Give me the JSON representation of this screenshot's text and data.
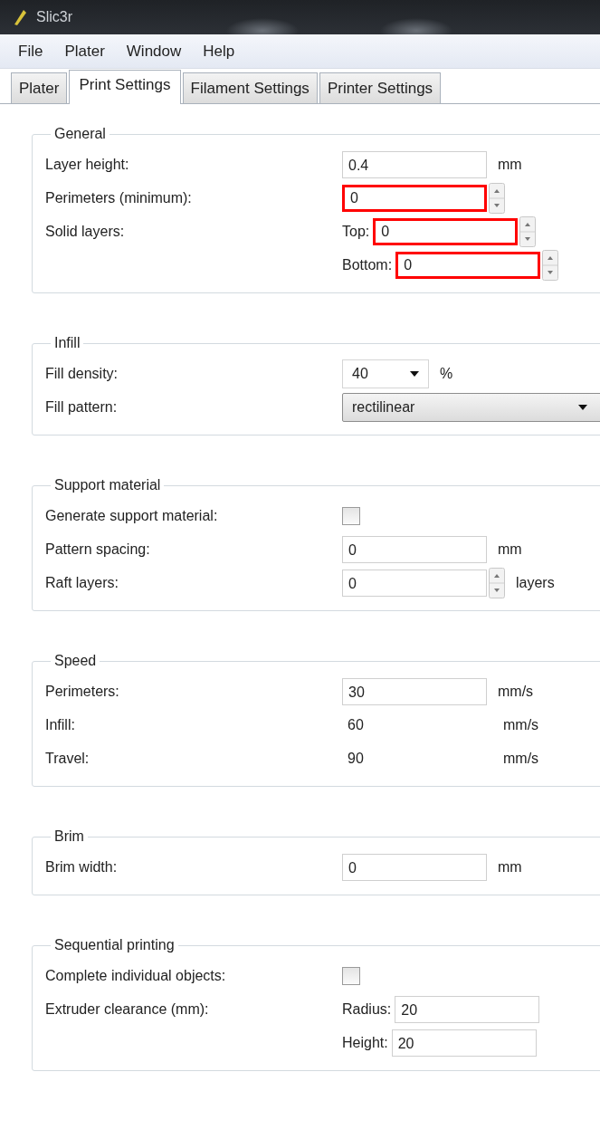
{
  "window": {
    "title": "Slic3r"
  },
  "menu": [
    "File",
    "Plater",
    "Window",
    "Help"
  ],
  "tabs": [
    {
      "label": "Plater",
      "selected": false
    },
    {
      "label": "Print Settings",
      "selected": true
    },
    {
      "label": "Filament Settings",
      "selected": false
    },
    {
      "label": "Printer Settings",
      "selected": false
    }
  ],
  "sections": [
    {
      "title": "General",
      "rows": [
        {
          "label": "Layer height:",
          "fields": [
            {
              "kind": "text",
              "value": "0.4",
              "unit": "mm",
              "highlighted": false
            }
          ]
        },
        {
          "label": "Perimeters (minimum):",
          "fields": [
            {
              "kind": "spin",
              "value": "0",
              "highlighted": true
            }
          ]
        },
        {
          "label": "Solid layers:",
          "fields": [
            {
              "kind": "spin",
              "label": "Top:",
              "value": "0",
              "highlighted": true
            },
            {
              "kind": "spin",
              "label": "Bottom:",
              "value": "0",
              "highlighted": true
            }
          ]
        }
      ]
    },
    {
      "title": "Infill",
      "rows": [
        {
          "label": "Fill density:",
          "fields": [
            {
              "kind": "combo",
              "value": "40",
              "unit": "%"
            }
          ]
        },
        {
          "label": "Fill pattern:",
          "fields": [
            {
              "kind": "combo",
              "value": "rectilinear"
            }
          ]
        }
      ]
    },
    {
      "title": "Support material",
      "rows": [
        {
          "label": "Generate support material:",
          "fields": [
            {
              "kind": "checkbox",
              "checked": false
            }
          ]
        },
        {
          "label": "Pattern spacing:",
          "fields": [
            {
              "kind": "text",
              "value": "0",
              "unit": "mm",
              "highlighted": false
            }
          ]
        },
        {
          "label": "Raft layers:",
          "fields": [
            {
              "kind": "spin",
              "value": "0",
              "unit": "layers",
              "highlighted": false
            }
          ]
        }
      ]
    },
    {
      "title": "Speed",
      "rows": [
        {
          "label": "Perimeters:",
          "fields": [
            {
              "kind": "text",
              "value": "30",
              "unit": "mm/s",
              "highlighted": false
            }
          ]
        },
        {
          "label": "Infill:",
          "fields": [
            {
              "kind": "plain",
              "value": "60",
              "unit": "mm/s"
            }
          ]
        },
        {
          "label": "Travel:",
          "fields": [
            {
              "kind": "plain",
              "value": "90",
              "unit": "mm/s"
            }
          ]
        }
      ]
    },
    {
      "title": "Brim",
      "rows": [
        {
          "label": "Brim width:",
          "fields": [
            {
              "kind": "text",
              "value": "0",
              "unit": "mm",
              "highlighted": false
            }
          ]
        }
      ]
    },
    {
      "title": "Sequential printing",
      "rows": [
        {
          "label": "Complete individual objects:",
          "fields": [
            {
              "kind": "checkbox",
              "checked": false
            }
          ]
        },
        {
          "label": "Extruder clearance (mm):",
          "fields": [
            {
              "kind": "text",
              "label": "Radius:",
              "value": "20",
              "highlighted": false
            },
            {
              "kind": "text",
              "label": "Height:",
              "value": "20",
              "highlighted": false
            }
          ]
        }
      ]
    }
  ]
}
